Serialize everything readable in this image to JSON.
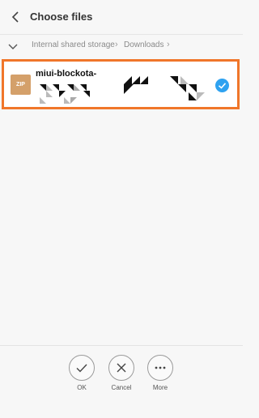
{
  "header": {
    "title": "Choose files"
  },
  "breadcrumb": {
    "items": [
      "Internal shared storage",
      "Downloads"
    ]
  },
  "file": {
    "type_badge": "ZIP",
    "name": "miui-blockota-",
    "selected": true
  },
  "actions": [
    {
      "label": "OK",
      "icon": "check-icon"
    },
    {
      "label": "Cancel",
      "icon": "close-icon"
    },
    {
      "label": "More",
      "icon": "more-icon"
    }
  ],
  "colors": {
    "selection_border": "#f0762a",
    "accent": "#2fa2f0",
    "zip": "#d4a06a"
  }
}
